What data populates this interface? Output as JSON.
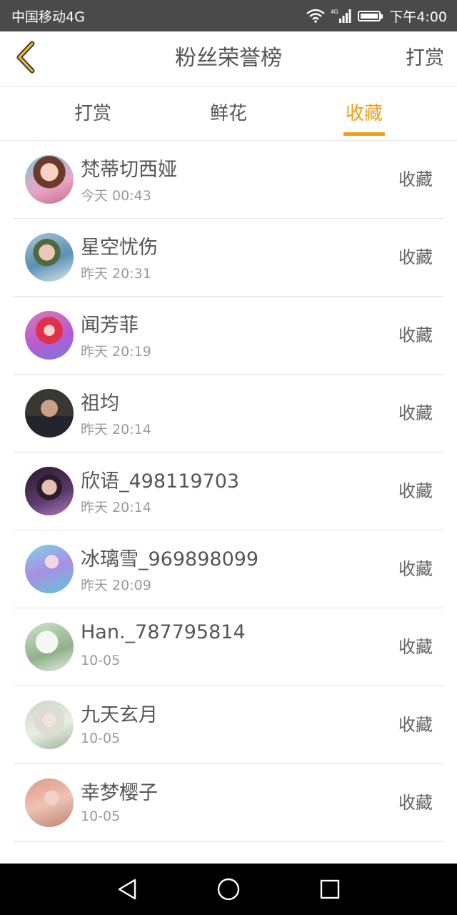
{
  "status_bar": {
    "carrier": "中国移动4G",
    "network_badge": "4G",
    "time": "下午4:00",
    "icons": [
      "wifi-icon",
      "signal-icon",
      "battery-icon"
    ]
  },
  "header": {
    "back_icon": "chevron-left-icon",
    "title": "粉丝荣誉榜",
    "action": "打赏"
  },
  "tabs": [
    {
      "label": "打赏",
      "active": false
    },
    {
      "label": "鲜花",
      "active": false
    },
    {
      "label": "收藏",
      "active": true
    }
  ],
  "list": [
    {
      "name": "梵蒂切西娅",
      "time": "今天 00:43",
      "action": "收藏"
    },
    {
      "name": "星空忧伤",
      "time": "昨天 20:31",
      "action": "收藏"
    },
    {
      "name": "闻芳菲",
      "time": "昨天 20:19",
      "action": "收藏"
    },
    {
      "name": "祖均",
      "time": "昨天 20:14",
      "action": "收藏"
    },
    {
      "name": "欣语_498119703",
      "time": "昨天 20:14",
      "action": "收藏"
    },
    {
      "name": "冰璃雪_969898099",
      "time": "昨天 20:09",
      "action": "收藏"
    },
    {
      "name": "Han._787795814",
      "time": "10-05",
      "action": "收藏"
    },
    {
      "name": "九天玄月",
      "time": "10-05",
      "action": "收藏"
    },
    {
      "name": "幸梦樱子",
      "time": "10-05",
      "action": "收藏"
    }
  ],
  "colors": {
    "accent": "#f0a01e",
    "text": "#555555",
    "secondary_text": "#9a9a9a",
    "status_bar": "#4a4a4a",
    "nav_bar": "#000000"
  },
  "nav_bar": {
    "icons": [
      "back-triangle-icon",
      "home-circle-icon",
      "recents-square-icon"
    ]
  }
}
